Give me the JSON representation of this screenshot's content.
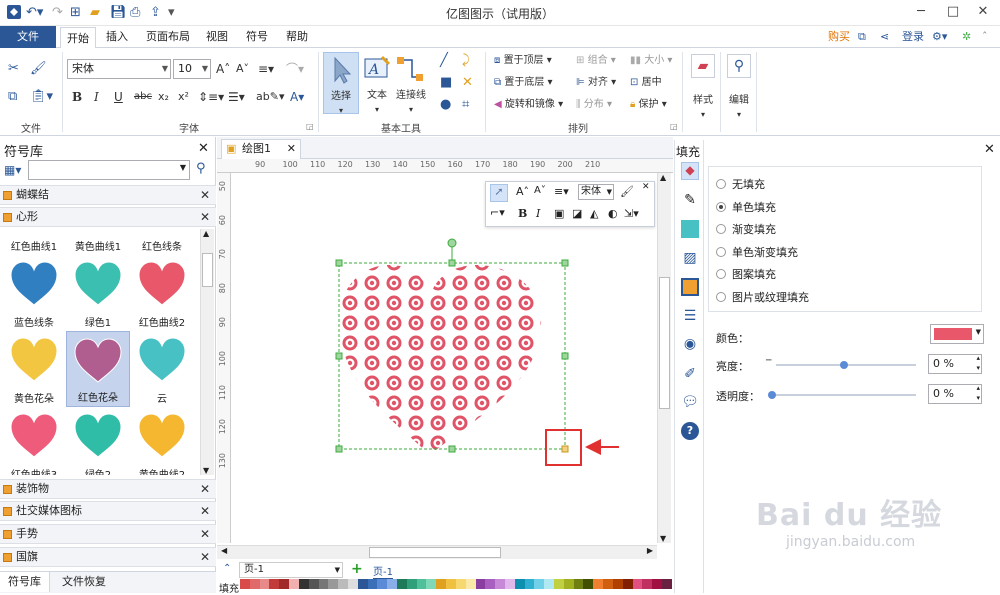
{
  "app": {
    "title": "亿图图示（试用版）"
  },
  "menu": {
    "file": "文件",
    "items": [
      "开始",
      "插入",
      "页面布局",
      "视图",
      "符号",
      "帮助"
    ],
    "buy": "购买",
    "login": "登录"
  },
  "ribbon": {
    "font_name": "宋体",
    "font_size": "10",
    "groups": {
      "file": "文件",
      "font": "字体",
      "basic_tools": "基本工具",
      "arrange": "排列"
    },
    "tools": {
      "select": "选择",
      "text": "文本",
      "connector": "连接线"
    },
    "arrange": {
      "bring_front": "置于顶层",
      "send_back": "置于底层",
      "rotate_mirror": "旋转和镜像",
      "group": "组合",
      "size": "大小",
      "align": "对齐",
      "center": "居中",
      "distribute": "分布",
      "protect": "保护"
    },
    "style": "样式",
    "edit": "编辑"
  },
  "library": {
    "title": "符号库",
    "categories_top": [
      "蝴蝶结",
      "心形"
    ],
    "shapes": [
      {
        "label": "红色曲线1",
        "color": "#e8586a"
      },
      {
        "label": "黄色曲线1",
        "color": "#f5c242"
      },
      {
        "label": "红色线条",
        "color": "#e8586a"
      },
      {
        "label": "蓝色线条",
        "color": "#2f7fc1"
      },
      {
        "label": "绿色1",
        "color": "#3bbfb0"
      },
      {
        "label": "红色曲线2",
        "color": "#e8586a"
      },
      {
        "label": "黄色花朵",
        "color": "#f2c640"
      },
      {
        "label": "红色花朵",
        "color": "#b05d8f"
      },
      {
        "label": "云",
        "color": "#48c1c4"
      },
      {
        "label": "红色曲线3",
        "color": "#ef5b7b"
      },
      {
        "label": "绿色2",
        "color": "#2fbda8"
      },
      {
        "label": "黄色曲线2",
        "color": "#f5b72f"
      }
    ],
    "categories_bottom": [
      "装饰物",
      "社交媒体图标",
      "手势",
      "国旗"
    ],
    "tabs": [
      "符号库",
      "文件恢复"
    ]
  },
  "canvas": {
    "tab": "绘图1",
    "ruler_top": [
      "90",
      "100",
      "110",
      "120",
      "130",
      "140",
      "150",
      "160",
      "170",
      "180",
      "190",
      "200",
      "210"
    ],
    "ruler_left": [
      "50",
      "60",
      "70",
      "80",
      "90",
      "100",
      "110",
      "120",
      "130"
    ],
    "float_font": "宋体",
    "heart_color": "#e05468"
  },
  "page": {
    "current": "页-1",
    "tab": "页-1",
    "fill_label": "填充"
  },
  "fill": {
    "title": "填充",
    "options": [
      "无填充",
      "单色填充",
      "渐变填充",
      "单色渐变填充",
      "图案填充",
      "图片或纹理填充"
    ],
    "selected_index": 1,
    "color_label": "颜色：",
    "color_value": "#e8586a",
    "brightness_label": "亮度：",
    "brightness_value": "0 %",
    "transparency_label": "透明度：",
    "transparency_value": "0 %"
  },
  "watermark": {
    "brand": "Bai du 经验",
    "url": "jingyan.baidu.com"
  }
}
